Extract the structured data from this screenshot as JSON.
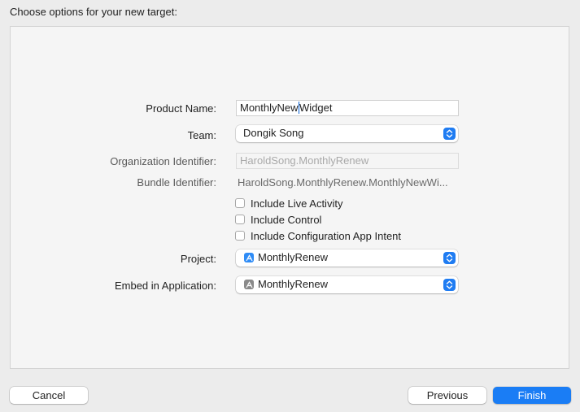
{
  "heading": "Choose options for your new target:",
  "form": {
    "product_name": {
      "label": "Product Name:",
      "value_before_caret": "MonthlyNew",
      "value_after_caret": "Widget"
    },
    "team": {
      "label": "Team:",
      "value": "Dongik Song",
      "icon": "chevron-updown-icon"
    },
    "organization_identifier": {
      "label": "Organization Identifier:",
      "placeholder": "HaroldSong.MonthlyRenew"
    },
    "bundle_identifier": {
      "label": "Bundle Identifier:",
      "value": "HaroldSong.MonthlyRenew.MonthlyNewWi..."
    },
    "options": [
      {
        "label": "Include Live Activity",
        "checked": false
      },
      {
        "label": "Include Control",
        "checked": false
      },
      {
        "label": "Include Configuration App Intent",
        "checked": false
      }
    ],
    "project": {
      "label": "Project:",
      "value": "MonthlyRenew",
      "icon": "xcode-project-icon"
    },
    "embed_in_application": {
      "label": "Embed in Application:",
      "value": "MonthlyRenew",
      "icon": "app-icon"
    }
  },
  "buttons": {
    "cancel": "Cancel",
    "previous": "Previous",
    "finish": "Finish"
  },
  "colors": {
    "accent": "#1a7df5",
    "window_bg": "#ececec",
    "panel_bg": "#f5f5f5"
  }
}
